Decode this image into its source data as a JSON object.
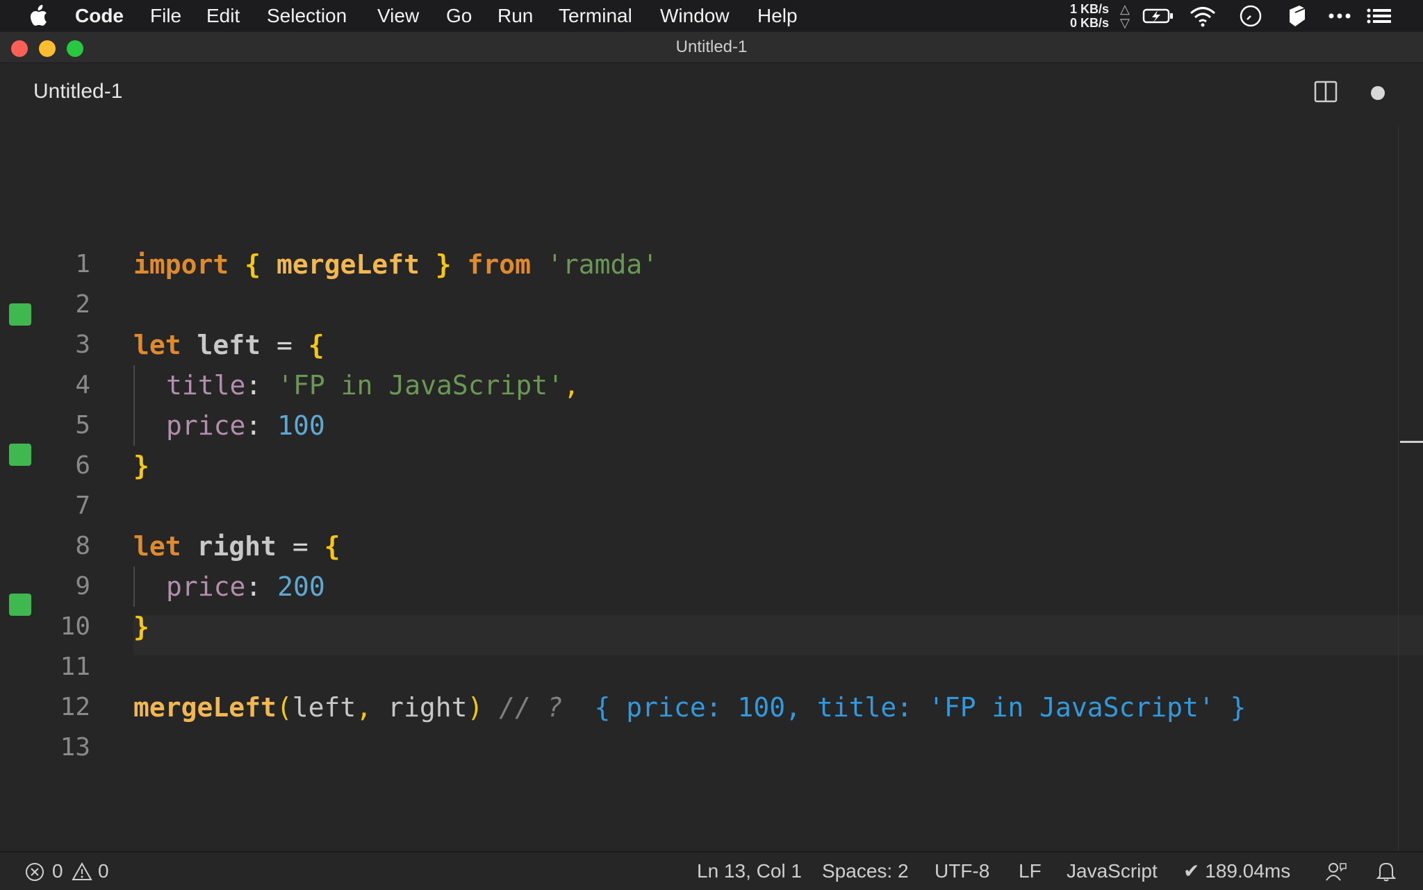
{
  "menubar": {
    "app_name": "Code",
    "items": [
      "File",
      "Edit",
      "Selection",
      "View",
      "Go",
      "Run",
      "Terminal",
      "Window",
      "Help"
    ],
    "net_up": "1 KB/s",
    "net_down": "0 KB/s",
    "icons": [
      "apple-icon",
      "battery-charging-icon",
      "wifi-icon",
      "clock-icon",
      "box-icon",
      "more-icon",
      "list-icon"
    ]
  },
  "window": {
    "title": "Untitled-1",
    "traffic_colors": {
      "close": "#ff5f57",
      "minimize": "#febc2e",
      "zoom": "#28c840"
    }
  },
  "tab": {
    "label": "Untitled-1",
    "dirty": true
  },
  "editor": {
    "lines": [
      {
        "n": "1",
        "marked": false
      },
      {
        "n": "2",
        "marked": false
      },
      {
        "n": "3",
        "marked": true
      },
      {
        "n": "4",
        "marked": false
      },
      {
        "n": "5",
        "marked": false
      },
      {
        "n": "6",
        "marked": false
      },
      {
        "n": "7",
        "marked": false
      },
      {
        "n": "8",
        "marked": true
      },
      {
        "n": "9",
        "marked": false
      },
      {
        "n": "10",
        "marked": false
      },
      {
        "n": "11",
        "marked": false
      },
      {
        "n": "12",
        "marked": true
      },
      {
        "n": "13",
        "marked": false
      }
    ],
    "code": {
      "l1": {
        "import": "import",
        "open": "{",
        "name": "mergeLeft",
        "close": "}",
        "from": "from",
        "module": "'ramda'"
      },
      "l3": {
        "let": "let",
        "name": "left",
        "eq": "=",
        "open": "{"
      },
      "l4": {
        "prop": "title",
        "colon": ":",
        "value": "'FP in JavaScript'",
        "comma": ","
      },
      "l5": {
        "prop": "price",
        "colon": ":",
        "value": "100"
      },
      "l6": {
        "close": "}"
      },
      "l8": {
        "let": "let",
        "name": "right",
        "eq": "=",
        "open": "{"
      },
      "l9": {
        "prop": "price",
        "colon": ":",
        "value": "200"
      },
      "l10": {
        "close": "}"
      },
      "l12": {
        "fn": "mergeLeft",
        "paren_open": "(",
        "arg1": "left",
        "comma": ",",
        "arg2": "right",
        "paren_close": ")",
        "comment": "// ?",
        "result": "{ price: 100, title: 'FP in JavaScript' }"
      }
    },
    "marker_color": "#3fb94f"
  },
  "statusbar": {
    "errors": "0",
    "warnings": "0",
    "position": "Ln 13, Col 1",
    "spaces": "Spaces: 2",
    "encoding": "UTF-8",
    "eol": "LF",
    "language": "JavaScript",
    "timing": "189.04ms"
  }
}
